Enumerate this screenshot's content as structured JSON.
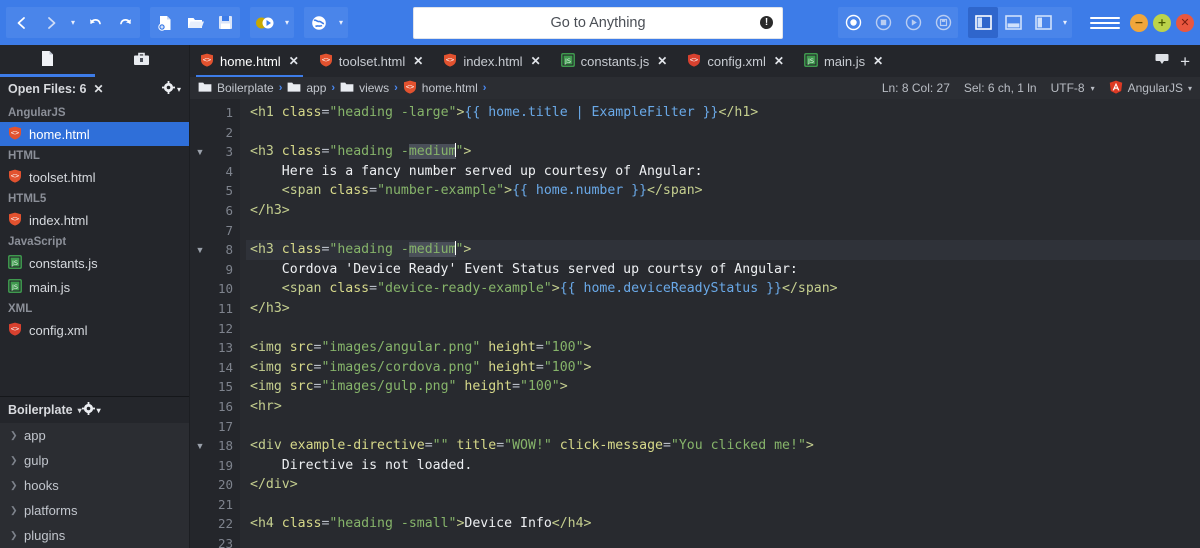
{
  "toolbar": {
    "nav": [
      {
        "name": "back-button",
        "glyph": "‹"
      },
      {
        "name": "forward-button",
        "glyph": "›"
      },
      {
        "name": "nav-dropdown",
        "glyph": "▾"
      },
      {
        "name": "undo-button",
        "glyph": "↶"
      },
      {
        "name": "redo-button",
        "glyph": "↷"
      }
    ],
    "file": [
      {
        "name": "new-file-button",
        "glyph": "new"
      },
      {
        "name": "open-file-button",
        "glyph": "open"
      },
      {
        "name": "save-file-button",
        "glyph": "save"
      }
    ],
    "run": [
      {
        "name": "run-command-button",
        "glyph": "run"
      },
      {
        "name": "run-dropdown",
        "glyph": "▾"
      }
    ],
    "preview": [
      {
        "name": "preview-browser-button",
        "glyph": "globe"
      },
      {
        "name": "preview-dropdown",
        "glyph": "▾"
      }
    ],
    "macro": [
      {
        "name": "macro-record-button",
        "glyph": "record"
      },
      {
        "name": "macro-stop-button",
        "glyph": "stop"
      },
      {
        "name": "macro-play-button",
        "glyph": "play"
      },
      {
        "name": "macro-save-button",
        "glyph": "savemacro"
      }
    ],
    "panes": [
      {
        "name": "toggle-left-pane-button",
        "glyph": "left",
        "active": true
      },
      {
        "name": "toggle-bottom-pane-button",
        "glyph": "bottom",
        "active": false
      },
      {
        "name": "toggle-right-pane-button",
        "glyph": "right",
        "active": false
      },
      {
        "name": "panes-dropdown",
        "glyph": "▾"
      }
    ],
    "menu_label": "hamburger-menu",
    "window_buttons": [
      {
        "name": "minimize-button",
        "glyph": "−"
      },
      {
        "name": "maximize-button",
        "glyph": "+"
      },
      {
        "name": "close-button",
        "glyph": "✕"
      }
    ]
  },
  "omnibox": {
    "placeholder": "Go to Anything",
    "info_glyph": "!"
  },
  "sidebar": {
    "tabs": [
      {
        "name": "sidebar-tab-files",
        "icon": "document-icon",
        "active": true
      },
      {
        "name": "sidebar-tab-toolbox",
        "icon": "toolbox-icon",
        "active": false
      }
    ],
    "open_files": {
      "title": "Open Files: 6",
      "close_glyph": "✕",
      "gear_glyph": "⚙",
      "caret": "▾",
      "groups": [
        {
          "label": "AngularJS",
          "files": [
            {
              "name": "home.html",
              "type": "html",
              "selected": true
            }
          ]
        },
        {
          "label": "HTML",
          "files": [
            {
              "name": "toolset.html",
              "type": "html",
              "selected": false
            }
          ]
        },
        {
          "label": "HTML5",
          "files": [
            {
              "name": "index.html",
              "type": "html",
              "selected": false
            }
          ]
        },
        {
          "label": "JavaScript",
          "files": [
            {
              "name": "constants.js",
              "type": "js",
              "selected": false
            },
            {
              "name": "main.js",
              "type": "js",
              "selected": false
            }
          ]
        },
        {
          "label": "XML",
          "files": [
            {
              "name": "config.xml",
              "type": "xml",
              "selected": false
            }
          ]
        }
      ]
    },
    "project": {
      "title": "Boilerplate",
      "caret": "▾",
      "gear_glyph": "⚙",
      "items": [
        {
          "label": "app"
        },
        {
          "label": "gulp"
        },
        {
          "label": "hooks"
        },
        {
          "label": "platforms"
        },
        {
          "label": "plugins"
        }
      ]
    }
  },
  "editor_tabs": {
    "items": [
      {
        "label": "home.html",
        "type": "html",
        "active": true
      },
      {
        "label": "toolset.html",
        "type": "html",
        "active": false
      },
      {
        "label": "index.html",
        "type": "html",
        "active": false
      },
      {
        "label": "constants.js",
        "type": "js",
        "active": false
      },
      {
        "label": "config.xml",
        "type": "xml",
        "active": false
      },
      {
        "label": "main.js",
        "type": "js",
        "active": false
      }
    ],
    "close_glyph": "✕",
    "list_button": "tab-list-button",
    "new_tab_glyph": "+"
  },
  "breadcrumb": {
    "items": [
      {
        "label": "Boilerplate",
        "icon": "folder-icon"
      },
      {
        "label": "app",
        "icon": "folder-icon"
      },
      {
        "label": "views",
        "icon": "folder-icon"
      },
      {
        "label": "home.html",
        "icon": "html-file-icon"
      }
    ],
    "chevron": "›"
  },
  "status": {
    "position": "Ln: 8 Col: 27",
    "selection": "Sel: 6 ch, 1 ln",
    "encoding": "UTF-8",
    "encoding_caret": "▾",
    "language": "AngularJS",
    "language_caret": "▾"
  },
  "code": {
    "lines": [
      {
        "n": 1,
        "fold": false,
        "current": false,
        "spans": [
          {
            "t": "<h1 ",
            "c": "tg"
          },
          {
            "t": "class",
            "c": "at"
          },
          {
            "t": "=",
            "c": "eq"
          },
          {
            "t": "\"heading -large\"",
            "c": "st"
          },
          {
            "t": ">",
            "c": "tg"
          },
          {
            "t": "{{ home.title | ExampleFilter }}",
            "c": "ng"
          },
          {
            "t": "</h1>",
            "c": "tg"
          }
        ]
      },
      {
        "n": 2,
        "fold": false,
        "current": false,
        "spans": []
      },
      {
        "n": 3,
        "fold": true,
        "current": false,
        "spans": [
          {
            "t": "<h3 ",
            "c": "tg"
          },
          {
            "t": "class",
            "c": "at"
          },
          {
            "t": "=",
            "c": "eq"
          },
          {
            "t": "\"heading -",
            "c": "st"
          },
          {
            "t": "medium",
            "c": "st sel"
          },
          {
            "t": "|",
            "c": "caret"
          },
          {
            "t": "\"",
            "c": "st"
          },
          {
            "t": ">",
            "c": "tg"
          }
        ]
      },
      {
        "n": 4,
        "fold": false,
        "current": false,
        "spans": [
          {
            "t": "    Here is a fancy number served up courtesy of Angular:",
            "c": "tx"
          }
        ]
      },
      {
        "n": 5,
        "fold": false,
        "current": false,
        "spans": [
          {
            "t": "    <span ",
            "c": "tg"
          },
          {
            "t": "class",
            "c": "at"
          },
          {
            "t": "=",
            "c": "eq"
          },
          {
            "t": "\"number-example\"",
            "c": "st"
          },
          {
            "t": ">",
            "c": "tg"
          },
          {
            "t": "{{ home.number }}",
            "c": "ng"
          },
          {
            "t": "</span>",
            "c": "tg"
          }
        ]
      },
      {
        "n": 6,
        "fold": false,
        "current": false,
        "spans": [
          {
            "t": "</h3>",
            "c": "tg"
          }
        ]
      },
      {
        "n": 7,
        "fold": false,
        "current": false,
        "spans": []
      },
      {
        "n": 8,
        "fold": true,
        "current": true,
        "spans": [
          {
            "t": "<h3 ",
            "c": "tg"
          },
          {
            "t": "class",
            "c": "at"
          },
          {
            "t": "=",
            "c": "eq"
          },
          {
            "t": "\"heading -",
            "c": "st"
          },
          {
            "t": "medium",
            "c": "st sel"
          },
          {
            "t": "|",
            "c": "caret"
          },
          {
            "t": "\"",
            "c": "st"
          },
          {
            "t": ">",
            "c": "tg"
          }
        ]
      },
      {
        "n": 9,
        "fold": false,
        "current": false,
        "spans": [
          {
            "t": "    Cordova 'Device Ready' Event Status served up courtsy of Angular:",
            "c": "tx"
          }
        ]
      },
      {
        "n": 10,
        "fold": false,
        "current": false,
        "spans": [
          {
            "t": "    <span ",
            "c": "tg"
          },
          {
            "t": "class",
            "c": "at"
          },
          {
            "t": "=",
            "c": "eq"
          },
          {
            "t": "\"device-ready-example\"",
            "c": "st"
          },
          {
            "t": ">",
            "c": "tg"
          },
          {
            "t": "{{ home.deviceReadyStatus }}",
            "c": "ng"
          },
          {
            "t": "</span>",
            "c": "tg"
          }
        ]
      },
      {
        "n": 11,
        "fold": false,
        "current": false,
        "spans": [
          {
            "t": "</h3>",
            "c": "tg"
          }
        ]
      },
      {
        "n": 12,
        "fold": false,
        "current": false,
        "spans": []
      },
      {
        "n": 13,
        "fold": false,
        "current": false,
        "spans": [
          {
            "t": "<img ",
            "c": "tg"
          },
          {
            "t": "src",
            "c": "at"
          },
          {
            "t": "=",
            "c": "eq"
          },
          {
            "t": "\"images/angular.png\"",
            "c": "st"
          },
          {
            "t": " ",
            "c": "eq"
          },
          {
            "t": "height",
            "c": "at"
          },
          {
            "t": "=",
            "c": "eq"
          },
          {
            "t": "\"100\"",
            "c": "st"
          },
          {
            "t": ">",
            "c": "tg"
          }
        ]
      },
      {
        "n": 14,
        "fold": false,
        "current": false,
        "spans": [
          {
            "t": "<img ",
            "c": "tg"
          },
          {
            "t": "src",
            "c": "at"
          },
          {
            "t": "=",
            "c": "eq"
          },
          {
            "t": "\"images/cordova.png\"",
            "c": "st"
          },
          {
            "t": " ",
            "c": "eq"
          },
          {
            "t": "height",
            "c": "at"
          },
          {
            "t": "=",
            "c": "eq"
          },
          {
            "t": "\"100\"",
            "c": "st"
          },
          {
            "t": ">",
            "c": "tg"
          }
        ]
      },
      {
        "n": 15,
        "fold": false,
        "current": false,
        "spans": [
          {
            "t": "<img ",
            "c": "tg"
          },
          {
            "t": "src",
            "c": "at"
          },
          {
            "t": "=",
            "c": "eq"
          },
          {
            "t": "\"images/gulp.png\"",
            "c": "st"
          },
          {
            "t": " ",
            "c": "eq"
          },
          {
            "t": "height",
            "c": "at"
          },
          {
            "t": "=",
            "c": "eq"
          },
          {
            "t": "\"100\"",
            "c": "st"
          },
          {
            "t": ">",
            "c": "tg"
          }
        ]
      },
      {
        "n": 16,
        "fold": false,
        "current": false,
        "spans": [
          {
            "t": "<hr>",
            "c": "tg"
          }
        ]
      },
      {
        "n": 17,
        "fold": false,
        "current": false,
        "spans": []
      },
      {
        "n": 18,
        "fold": true,
        "current": false,
        "spans": [
          {
            "t": "<div ",
            "c": "tg"
          },
          {
            "t": "example-directive",
            "c": "at"
          },
          {
            "t": "=",
            "c": "eq"
          },
          {
            "t": "\"\"",
            "c": "st"
          },
          {
            "t": " ",
            "c": "eq"
          },
          {
            "t": "title",
            "c": "at"
          },
          {
            "t": "=",
            "c": "eq"
          },
          {
            "t": "\"WOW!\"",
            "c": "st"
          },
          {
            "t": " ",
            "c": "eq"
          },
          {
            "t": "click-message",
            "c": "at"
          },
          {
            "t": "=",
            "c": "eq"
          },
          {
            "t": "\"You clicked me!\"",
            "c": "st"
          },
          {
            "t": ">",
            "c": "tg"
          }
        ]
      },
      {
        "n": 19,
        "fold": false,
        "current": false,
        "spans": [
          {
            "t": "    Directive is not loaded.",
            "c": "tx"
          }
        ]
      },
      {
        "n": 20,
        "fold": false,
        "current": false,
        "spans": [
          {
            "t": "</div>",
            "c": "tg"
          }
        ]
      },
      {
        "n": 21,
        "fold": false,
        "current": false,
        "spans": []
      },
      {
        "n": 22,
        "fold": false,
        "current": false,
        "spans": [
          {
            "t": "<h4 ",
            "c": "tg"
          },
          {
            "t": "class",
            "c": "at"
          },
          {
            "t": "=",
            "c": "eq"
          },
          {
            "t": "\"heading -small\"",
            "c": "st"
          },
          {
            "t": ">",
            "c": "tg"
          },
          {
            "t": "Device Info",
            "c": "tx"
          },
          {
            "t": "</h4>",
            "c": "tg"
          }
        ]
      },
      {
        "n": 23,
        "fold": false,
        "current": false,
        "spans": []
      }
    ]
  },
  "colors": {
    "toolbar_blue": "#3d7ce8",
    "accent_blue": "#3d7ce8",
    "sidebar_bg": "#24262b",
    "editor_bg": "#282a2f",
    "selection_blue": "#2f6fd9",
    "html_icon": "#e2522f",
    "js_icon": "#3f9a4e",
    "xml_icon": "#d8412f",
    "tag_color": "#c5cf8f",
    "string_color": "#86b46a",
    "angular_color": "#6aa9e8"
  }
}
